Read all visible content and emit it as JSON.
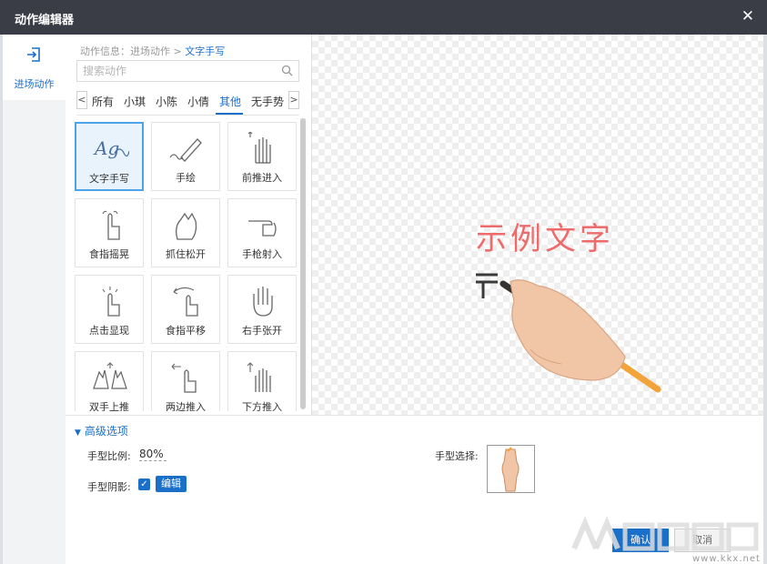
{
  "window": {
    "title": "动作编辑器",
    "close_glyph": "✕"
  },
  "sidebar": {
    "items": [
      {
        "label": "进场动作",
        "icon": "enter-icon",
        "active": true
      }
    ]
  },
  "breadcrumb": {
    "prefix": "动作信息：进场动作 >",
    "current": "文字手写"
  },
  "search": {
    "placeholder": "搜索动作",
    "value": ""
  },
  "tabs": {
    "prev": "<",
    "next": ">",
    "items": [
      {
        "label": "所有"
      },
      {
        "label": "小琪"
      },
      {
        "label": "小陈"
      },
      {
        "label": "小倩"
      },
      {
        "label": "其他",
        "active": true
      },
      {
        "label": "无手势"
      }
    ]
  },
  "actions": [
    {
      "label": "文字手写",
      "icon": "handwriting-icon",
      "selected": true
    },
    {
      "label": "手绘",
      "icon": "pen-draw-icon"
    },
    {
      "label": "前推进入",
      "icon": "hand-push-icon"
    },
    {
      "label": "食指摇晃",
      "icon": "finger-wave-icon"
    },
    {
      "label": "抓住松开",
      "icon": "hand-grab-icon"
    },
    {
      "label": "手枪射入",
      "icon": "hand-gun-icon"
    },
    {
      "label": "点击显现",
      "icon": "finger-tap-icon"
    },
    {
      "label": "食指平移",
      "icon": "finger-swipe-icon"
    },
    {
      "label": "右手张开",
      "icon": "open-hand-icon"
    },
    {
      "label": "双手上推",
      "icon": "two-hands-up-icon"
    },
    {
      "label": "两边推入",
      "icon": "side-push-icon"
    },
    {
      "label": "下方推入",
      "icon": "bottom-push-icon"
    }
  ],
  "preview": {
    "sample_text": "示例文字",
    "colors": {
      "text": "#ee6b6b",
      "pencil": "#f2a33a"
    }
  },
  "advanced": {
    "toggle_label": "高级选项",
    "scale_label": "手型比例:",
    "scale_value": "80%",
    "shadow_label": "手型阴影:",
    "shadow_checked": true,
    "edit_label": "编辑",
    "hand_select_label": "手型选择:"
  },
  "footer": {
    "ok_label": "确认",
    "cancel_label": "取消"
  },
  "watermark": {
    "url": "www.kkx.net"
  },
  "colors": {
    "accent": "#1a6fc9",
    "titlebar": "#3a3d45",
    "selected_border": "#4da3e6"
  }
}
